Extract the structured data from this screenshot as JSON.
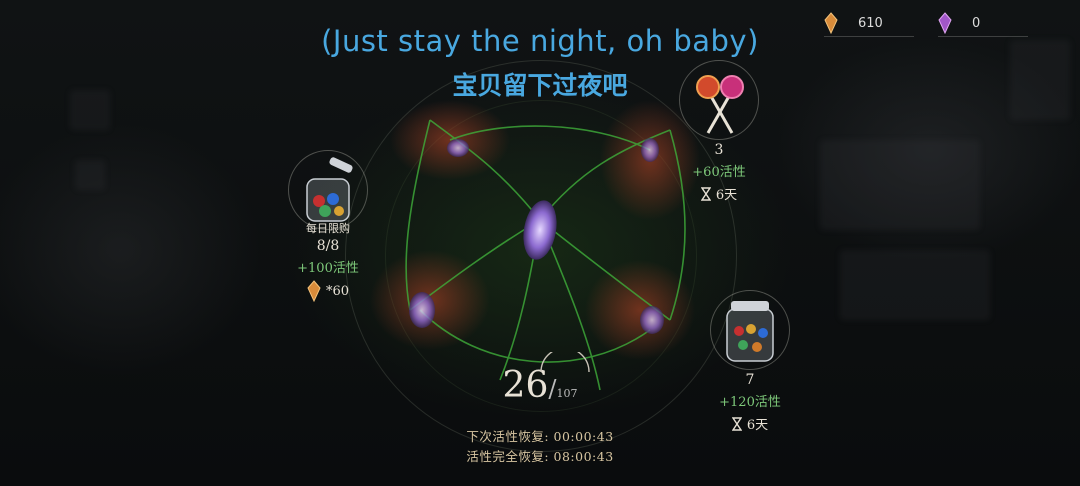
{
  "currencies": [
    {
      "icon": "amber-crystal-icon",
      "value": "610"
    },
    {
      "icon": "purple-crystal-icon",
      "value": "0"
    }
  ],
  "lyrics": {
    "english": "(Just stay the night, oh baby)",
    "chinese": "宝贝留下过夜吧"
  },
  "items": {
    "left": {
      "icon": "candy-jar-icon",
      "label": "每日限购",
      "count": "8/8",
      "bonus": "+100活性",
      "price_icon": "amber-crystal-icon",
      "price": "*60"
    },
    "top_right": {
      "icon": "lollipop-icon",
      "count": "3",
      "bonus": "+60活性",
      "time_icon": "hourglass-icon",
      "time": "6天"
    },
    "bottom_right": {
      "icon": "candy-jar-icon",
      "count": "7",
      "bonus": "+120活性",
      "time_icon": "hourglass-icon",
      "time": "6天"
    }
  },
  "energy": {
    "current": "26",
    "separator": "/",
    "max": "107"
  },
  "status": {
    "next_label": "下次活性恢复:",
    "next_time": "00:00:43",
    "full_label": "活性完全恢复:",
    "full_time": "08:00:43"
  },
  "colors": {
    "lyric": "#49a8e0",
    "bonus": "#7ec97a"
  }
}
